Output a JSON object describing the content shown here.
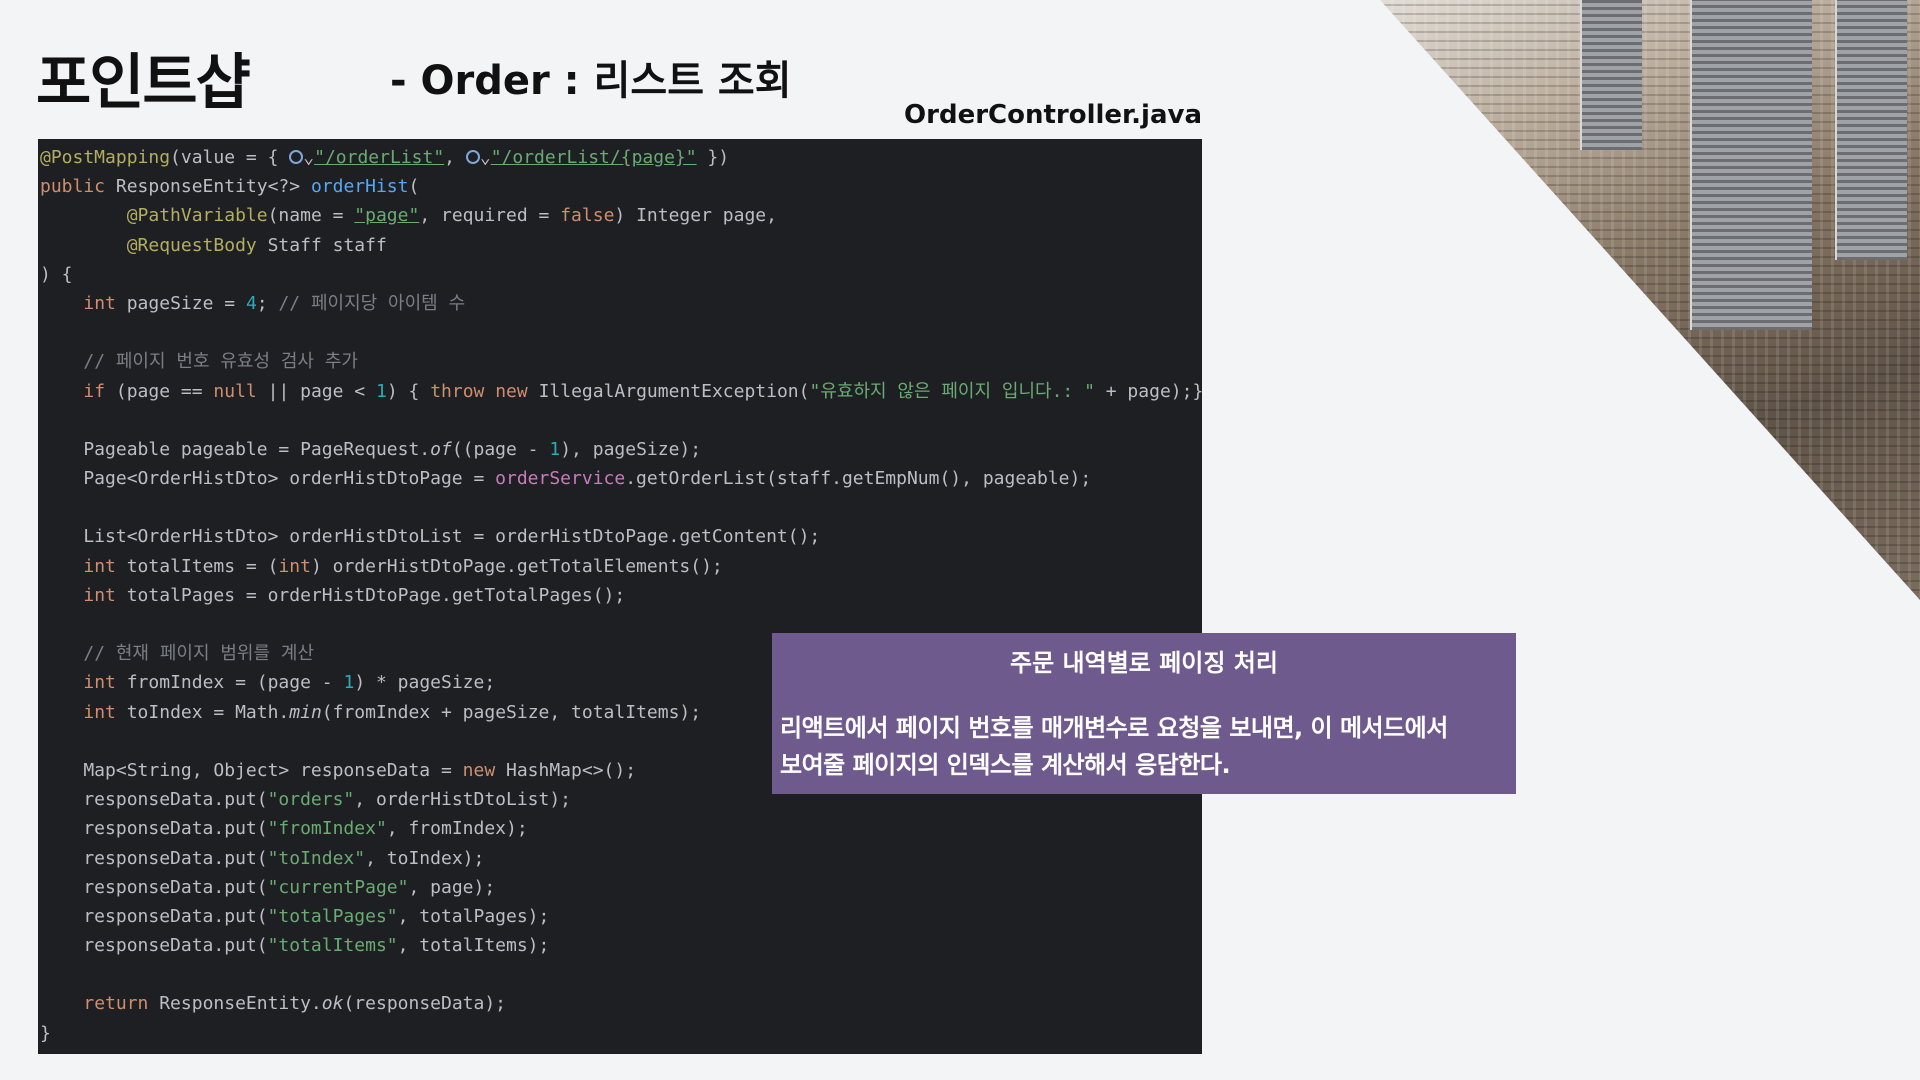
{
  "header": {
    "brand": "포인트샵",
    "subtitle": "- Order : 리스트 조회",
    "filename": "OrderController.java"
  },
  "code": {
    "lines": [
      [
        [
          "ann",
          "@PostMapping"
        ],
        [
          "",
          "(value = { "
        ],
        [
          "icon",
          "globe-icon"
        ],
        [
          "",
          "⌄"
        ],
        [
          "str-link",
          "\"/orderList\""
        ],
        [
          "",
          ", "
        ],
        [
          "icon",
          "globe-icon"
        ],
        [
          "",
          "⌄"
        ],
        [
          "str-link",
          "\"/orderList/{page}\""
        ],
        [
          "",
          " })"
        ]
      ],
      [
        [
          "kw",
          "public "
        ],
        [
          "",
          "ResponseEntity<?> "
        ],
        [
          "fn",
          "orderHist"
        ],
        [
          "",
          "("
        ]
      ],
      [
        [
          "",
          "        "
        ],
        [
          "ann",
          "@PathVariable"
        ],
        [
          "",
          "(name = "
        ],
        [
          "str-link",
          "\"page\""
        ],
        [
          "",
          ", required = "
        ],
        [
          "kw",
          "false"
        ],
        [
          "",
          ") Integer page,"
        ]
      ],
      [
        [
          "",
          "        "
        ],
        [
          "ann",
          "@RequestBody "
        ],
        [
          "",
          "Staff staff"
        ]
      ],
      [
        [
          "",
          ") {"
        ]
      ],
      [
        [
          "",
          "    "
        ],
        [
          "kw",
          "int "
        ],
        [
          "",
          "pageSize = "
        ],
        [
          "num",
          "4"
        ],
        [
          "",
          "; "
        ],
        [
          "cmt",
          "// 페이지당 아이템 수"
        ]
      ],
      [],
      [
        [
          "",
          "    "
        ],
        [
          "cmt",
          "// 페이지 번호 유효성 검사 추가"
        ]
      ],
      [
        [
          "",
          "    "
        ],
        [
          "kw",
          "if "
        ],
        [
          "",
          "(page == "
        ],
        [
          "kw",
          "null "
        ],
        [
          "",
          "|| page < "
        ],
        [
          "num",
          "1"
        ],
        [
          "",
          ") { "
        ],
        [
          "kw",
          "throw new "
        ],
        [
          "",
          "IllegalArgumentException("
        ],
        [
          "str",
          "\"유효하지 않은 페이지 입니다.: \""
        ],
        [
          "",
          " + page);}"
        ]
      ],
      [],
      [
        [
          "",
          "    Pageable pageable = PageRequest."
        ],
        [
          "it",
          "of"
        ],
        [
          "",
          "((page - "
        ],
        [
          "num",
          "1"
        ],
        [
          "",
          "), pageSize);"
        ]
      ],
      [
        [
          "",
          "    Page<OrderHistDto> orderHistDtoPage = "
        ],
        [
          "field",
          "orderService"
        ],
        [
          "",
          ".getOrderList(staff.getEmpNum(), pageable);"
        ]
      ],
      [],
      [
        [
          "",
          "    List<OrderHistDto> orderHistDtoList = orderHistDtoPage.getContent();"
        ]
      ],
      [
        [
          "",
          "    "
        ],
        [
          "kw",
          "int "
        ],
        [
          "",
          "totalItems = ("
        ],
        [
          "kw",
          "int"
        ],
        [
          "",
          ") orderHistDtoPage.getTotalElements();"
        ]
      ],
      [
        [
          "",
          "    "
        ],
        [
          "kw",
          "int "
        ],
        [
          "",
          "totalPages = orderHistDtoPage.getTotalPages();"
        ]
      ],
      [],
      [
        [
          "",
          "    "
        ],
        [
          "cmt",
          "// 현재 페이지 범위를 계산"
        ]
      ],
      [
        [
          "",
          "    "
        ],
        [
          "kw",
          "int "
        ],
        [
          "",
          "fromIndex = (page - "
        ],
        [
          "num",
          "1"
        ],
        [
          "",
          ") * pageSize;"
        ]
      ],
      [
        [
          "",
          "    "
        ],
        [
          "kw",
          "int "
        ],
        [
          "",
          "toIndex = Math."
        ],
        [
          "it",
          "min"
        ],
        [
          "",
          "(fromIndex + pageSize, totalItems);"
        ]
      ],
      [],
      [
        [
          "",
          "    Map<String, Object> responseData = "
        ],
        [
          "kw",
          "new "
        ],
        [
          "",
          "HashMap<>();"
        ]
      ],
      [
        [
          "",
          "    responseData.put("
        ],
        [
          "str",
          "\"orders\""
        ],
        [
          "",
          ", orderHistDtoList);"
        ]
      ],
      [
        [
          "",
          "    responseData.put("
        ],
        [
          "str",
          "\"fromIndex\""
        ],
        [
          "",
          ", fromIndex);"
        ]
      ],
      [
        [
          "",
          "    responseData.put("
        ],
        [
          "str",
          "\"toIndex\""
        ],
        [
          "",
          ", toIndex);"
        ]
      ],
      [
        [
          "",
          "    responseData.put("
        ],
        [
          "str",
          "\"currentPage\""
        ],
        [
          "",
          ", page);"
        ]
      ],
      [
        [
          "",
          "    responseData.put("
        ],
        [
          "str",
          "\"totalPages\""
        ],
        [
          "",
          ", totalPages);"
        ]
      ],
      [
        [
          "",
          "    responseData.put("
        ],
        [
          "str",
          "\"totalItems\""
        ],
        [
          "",
          ", totalItems);"
        ]
      ],
      [],
      [
        [
          "",
          "    "
        ],
        [
          "kw",
          "return "
        ],
        [
          "",
          "ResponseEntity."
        ],
        [
          "it",
          "ok"
        ],
        [
          "",
          "(responseData);"
        ]
      ],
      [
        [
          "",
          "}"
        ]
      ]
    ]
  },
  "callout": {
    "title": "주문 내역별로 페이징 처리",
    "body_line1": "리액트에서 페이지 번호를 매개변수로 요청을 보내면, 이 메서드에서",
    "body_line2": "보여줄 페이지의 인덱스를 계산해서 응답한다."
  }
}
